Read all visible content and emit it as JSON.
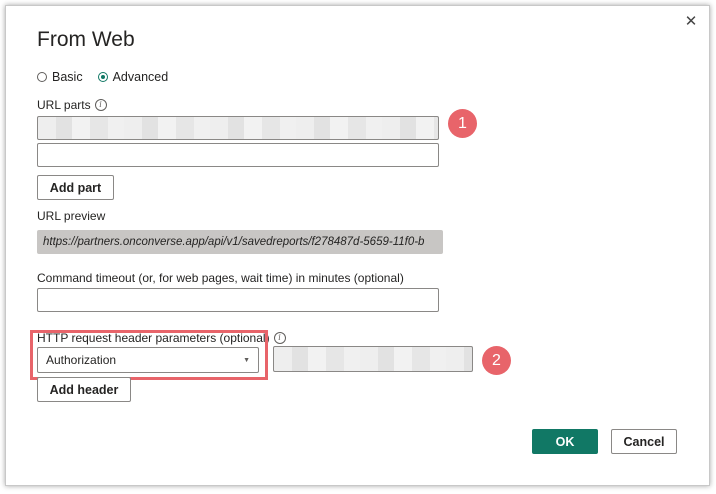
{
  "dialog": {
    "title": "From Web",
    "close_icon": "close-icon"
  },
  "mode": {
    "options": [
      {
        "label": "Basic",
        "selected": false
      },
      {
        "label": "Advanced",
        "selected": true
      }
    ]
  },
  "url_parts": {
    "label": "URL parts",
    "part1_value": "",
    "part2_value": "",
    "add_part_label": "Add part"
  },
  "url_preview": {
    "label": "URL preview",
    "value": "https://partners.onconverse.app/api/v1/savedreports/f278487d-5659-11f0-b"
  },
  "timeout": {
    "label": "Command timeout (or, for web pages, wait time) in minutes (optional)",
    "value": ""
  },
  "headers": {
    "label": "HTTP request header parameters (optional)",
    "selected_header": "Authorization",
    "value": "",
    "add_header_label": "Add header"
  },
  "callouts": {
    "one": "1",
    "two": "2"
  },
  "footer": {
    "ok_label": "OK",
    "cancel_label": "Cancel"
  },
  "colors": {
    "accent": "#117865",
    "callout": "#e8646a"
  }
}
